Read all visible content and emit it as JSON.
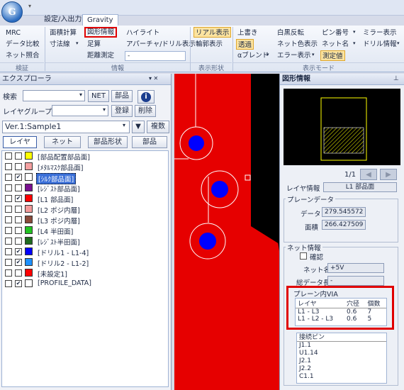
{
  "app": {
    "tabs": [
      "設定/入出力",
      "Gravity"
    ]
  },
  "ribbon": {
    "g1": [
      "MRC",
      "データ比較",
      "ネット照合"
    ],
    "g2a": [
      "面積計算",
      "寸法線"
    ],
    "g2b": [
      "図形情報",
      "足算",
      "距離測定"
    ],
    "g2c": [
      "ハイライト",
      "アパーチャ/ドリル表示"
    ],
    "g3": [
      "リアル表示",
      "輪郭表示"
    ],
    "g4a": [
      "上書き",
      "透過",
      "αブレンド"
    ],
    "g4b": [
      "白黒反転",
      "ネット色表示",
      "エラー表示"
    ],
    "g4c": [
      "ピン番号",
      "ネット名",
      "測定値"
    ],
    "g4d": [
      "ミラー表示",
      "ドリル情報"
    ],
    "groups": [
      "検証",
      "情報",
      "表示形状",
      "表示モード"
    ]
  },
  "explorer": {
    "title": "エクスプローラ",
    "search_label": "検索",
    "net_btn": "NET",
    "parts_btn": "部品",
    "info_icon": "i",
    "layer_group_label": "レイヤグループ",
    "register_btn": "登録",
    "delete_btn": "削除",
    "version": "Ver.1:Sample1",
    "multi_btn": "複数",
    "tabs": [
      "レイヤ",
      "ネット",
      "部品形状",
      "部品"
    ],
    "layers": [
      {
        "label": "[部品配置部品面]",
        "color": "#ffff00",
        "checked": false
      },
      {
        "label": "[ﾒﾀﾙﾏｽｸ部品面]",
        "color": "#f4a0a0",
        "checked": false
      },
      {
        "label": "[ｼﾙｸ部品面]",
        "color": "#ffffff",
        "checked": true,
        "selected": true
      },
      {
        "label": "[ﾚｼﾞｽﾄ部品面]",
        "color": "#7a1090",
        "checked": false
      },
      {
        "label": "[L1 部品面]",
        "color": "#ff0000",
        "checked": true
      },
      {
        "label": "[L2 ポジ内層]",
        "color": "#f29a9a",
        "checked": false
      },
      {
        "label": "[L3 ポジ内層]",
        "color": "#8a4a3a",
        "checked": false
      },
      {
        "label": "[L4 半田面]",
        "color": "#22c322",
        "checked": false
      },
      {
        "label": "[ﾚｼﾞｽﾄ半田面]",
        "color": "#1f6b1f",
        "checked": false
      },
      {
        "label": "[ドリル1 - L1-4]",
        "color": "#0000ff",
        "checked": true
      },
      {
        "label": "[ドリル2 - L1-2]",
        "color": "#1e90ff",
        "checked": true
      },
      {
        "label": "[未設定1]",
        "color": "#ff0000",
        "checked": false
      },
      {
        "label": "[PROFILE_DATA]",
        "color": "#ffffff",
        "checked": true
      }
    ]
  },
  "shape_info": {
    "title": "図形情報",
    "page": "1/1",
    "layer_info_label": "レイヤ情報",
    "layer_info_value": "L1 部品面",
    "plane_data_label": "プレーンデータ",
    "data_label": "データ",
    "data_value": "279.545572",
    "area_label": "面積",
    "area_value": "266.427509",
    "net_info_label": "ネット情報",
    "confirm_label": "確認",
    "net_name_label": "ネット名",
    "net_name_value": "+5V",
    "total_len_label": "総データ長",
    "total_len_value": "-",
    "via_title": "プレーン内VIA",
    "via_headers": [
      "レイヤ",
      "穴径",
      "個数"
    ],
    "via_rows": [
      [
        "L1 - L3",
        "0.6",
        "7"
      ],
      [
        "L1 - L2 - L3",
        "0.6",
        "5"
      ]
    ],
    "pins_label": "接続ピン",
    "pins": [
      "J1.1",
      "U1.14",
      "J2.1",
      "J2.2",
      "C1.1"
    ]
  }
}
